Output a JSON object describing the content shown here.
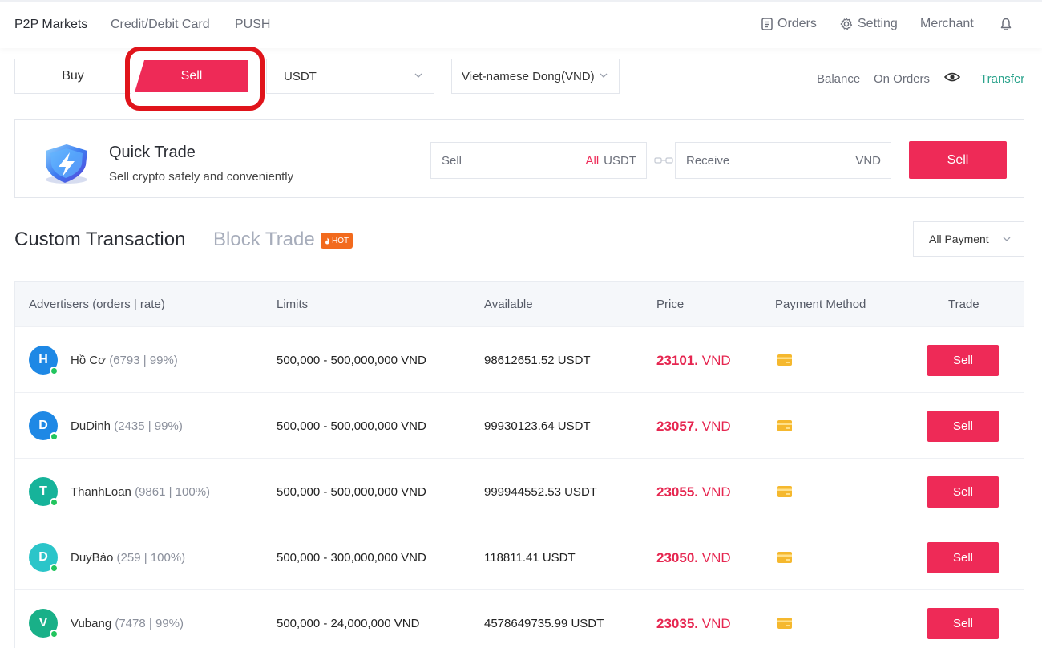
{
  "nav": {
    "tabs": [
      {
        "label": "P2P Markets",
        "active": true
      },
      {
        "label": "Credit/Debit Card",
        "active": false
      },
      {
        "label": "PUSH",
        "active": false
      }
    ],
    "orders_label": "Orders",
    "setting_label": "Setting",
    "merchant_label": "Merchant",
    "icons": [
      "orders-icon",
      "gear-icon",
      "bell-icon"
    ]
  },
  "trade_side": {
    "buy_label": "Buy",
    "sell_label": "Sell",
    "selected": "Sell"
  },
  "selects": {
    "coin": "USDT",
    "fiat": "Viet-namese Dong(VND)"
  },
  "balance": {
    "balance_label": "Balance",
    "on_orders_label": "On Orders",
    "transfer_label": "Transfer"
  },
  "quick_trade": {
    "title": "Quick Trade",
    "subtitle": "Sell crypto safely and conveniently",
    "sell_field_label": "Sell",
    "sell_all_label": "All",
    "sell_currency": "USDT",
    "receive_field_label": "Receive",
    "receive_currency": "VND",
    "button_label": "Sell"
  },
  "section": {
    "custom_title": "Custom Transaction",
    "block_title": "Block Trade",
    "hot_badge": "HOT",
    "payment_filter": "All Payment"
  },
  "table": {
    "headers": {
      "advertisers": "Advertisers (orders | rate)",
      "limits": "Limits",
      "available": "Available",
      "price": "Price",
      "payment": "Payment Method",
      "trade": "Trade"
    },
    "rows": [
      {
        "initial": "H",
        "avatar_color": "#1e88e5",
        "name": "Hồ Cơ",
        "stats": "(6793 | 99%)",
        "limits": "500,000 -  500,000,000 VND",
        "available": "98612651.52 USDT",
        "price": "23101.",
        "price_currency": "VND",
        "trade_label": "Sell"
      },
      {
        "initial": "D",
        "avatar_color": "#1e88e5",
        "name": "DuDinh",
        "stats": "(2435 | 99%)",
        "limits": "500,000 -  500,000,000 VND",
        "available": "99930123.64 USDT",
        "price": "23057.",
        "price_currency": "VND",
        "trade_label": "Sell"
      },
      {
        "initial": "T",
        "avatar_color": "#16b39a",
        "name": "ThanhLoan",
        "stats": "(9861 | 100%)",
        "limits": "500,000 -  500,000,000 VND",
        "available": "999944552.53 USDT",
        "price": "23055.",
        "price_currency": "VND",
        "trade_label": "Sell"
      },
      {
        "initial": "D",
        "avatar_color": "#2bc5c9",
        "name": "DuyBảo",
        "stats": "(259 | 100%)",
        "limits": "500,000 -  300,000,000 VND",
        "available": "118811.41 USDT",
        "price": "23050.",
        "price_currency": "VND",
        "trade_label": "Sell"
      },
      {
        "initial": "V",
        "avatar_color": "#19b088",
        "name": "Vubang",
        "stats": "(7478 | 99%)",
        "limits": "500,000 -  24,000,000 VND",
        "available": "4578649735.99 USDT",
        "price": "23035.",
        "price_currency": "VND",
        "trade_label": "Sell"
      }
    ]
  },
  "colors": {
    "accent": "#ee2a57",
    "price": "#e62650",
    "transfer": "#2ba38c",
    "highlight_ring": "#e0141b",
    "payment_icon": "#f5b82e"
  }
}
